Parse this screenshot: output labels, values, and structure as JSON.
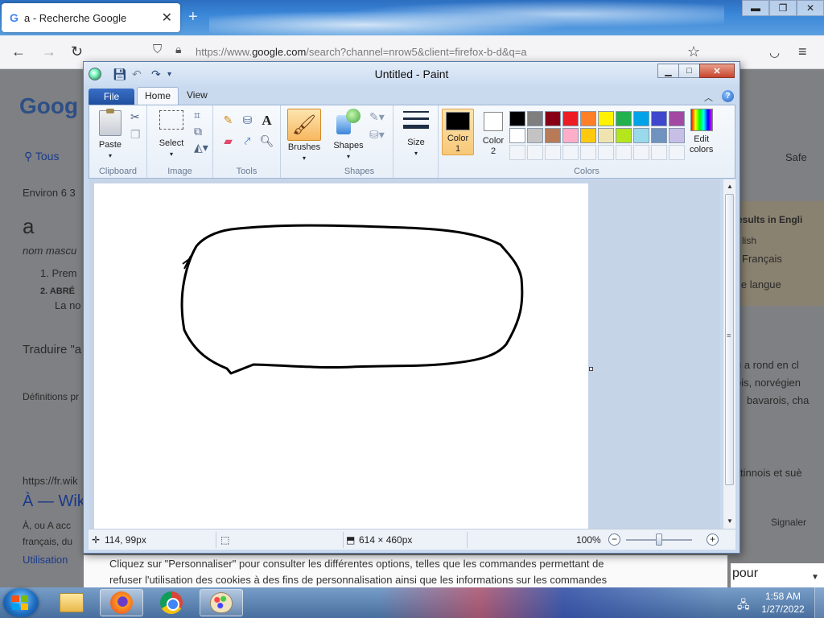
{
  "browser": {
    "tab_title": "a - Recherche Google",
    "tab_favicon": "G",
    "url_prefix": "https://www.",
    "url_domain": "google.com",
    "url_rest": "/search?channel=nrow5&client=firefox-b-d&q=a"
  },
  "google": {
    "logo": "Goog",
    "tab_all": "Tous",
    "result_count": "Environ 6 3",
    "word": "a",
    "word_type": "nom mascu",
    "def1": "1.  Prem",
    "def2": "2.  ABRÉ",
    "def2b": "La no",
    "translate": "Traduire \"a",
    "definitions_from": "Définitions pr",
    "result_url": "https://fr.wik",
    "result_title": "À — Wik",
    "snippet1": "À, ou A acc",
    "snippet2": "français, du",
    "snippet3": "Utilisation",
    "safesearch": "Safe",
    "panel_title": "esults in Engli",
    "panel_item1": "lish",
    "panel_item2": "Français",
    "panel_item3": "le langue",
    "right1": "u a rond en cl",
    "right2": "ois, norvégien",
    "right3": "bavarois, cha",
    "right4": "tinnois et suè",
    "report": "Signaler"
  },
  "cookie": {
    "line1": "Cliquez sur \"Personnaliser\" pour consulter les différentes options, telles que les commandes permettant de",
    "line2": "refuser l'utilisation des cookies à des fins de personnalisation ainsi que les informations sur les commandes",
    "right": "pour"
  },
  "paint": {
    "window_title": "Untitled - Paint",
    "tabs": {
      "file": "File",
      "home": "Home",
      "view": "View"
    },
    "clipboard": {
      "paste": "Paste",
      "group": "Clipboard"
    },
    "image": {
      "select": "Select",
      "group": "Image"
    },
    "tools_group": "Tools",
    "brushes": "Brushes",
    "shapes": {
      "label": "Shapes",
      "group": "Shapes"
    },
    "size": "Size",
    "color1": {
      "line1": "Color",
      "line2": "1"
    },
    "color2": {
      "line1": "Color",
      "line2": "2"
    },
    "edit_colors": {
      "line1": "Edit",
      "line2": "colors"
    },
    "colors_group": "Colors",
    "palette_row1": [
      "#000000",
      "#7f7f7f",
      "#880015",
      "#ed1c24",
      "#ff7f27",
      "#fff200",
      "#22b14c",
      "#00a2e8",
      "#3f48cc",
      "#a349a4"
    ],
    "palette_row2": [
      "#ffffff",
      "#c3c3c3",
      "#b97a57",
      "#ffaec9",
      "#ffc90e",
      "#efe4b0",
      "#b5e61d",
      "#99d9ea",
      "#7092be",
      "#c8bfe7"
    ],
    "status": {
      "cursor": "114, 99px",
      "canvas_size": "614 × 460px",
      "zoom": "100%"
    }
  },
  "taskbar": {
    "time": "1:58 AM",
    "date": "1/27/2022"
  }
}
